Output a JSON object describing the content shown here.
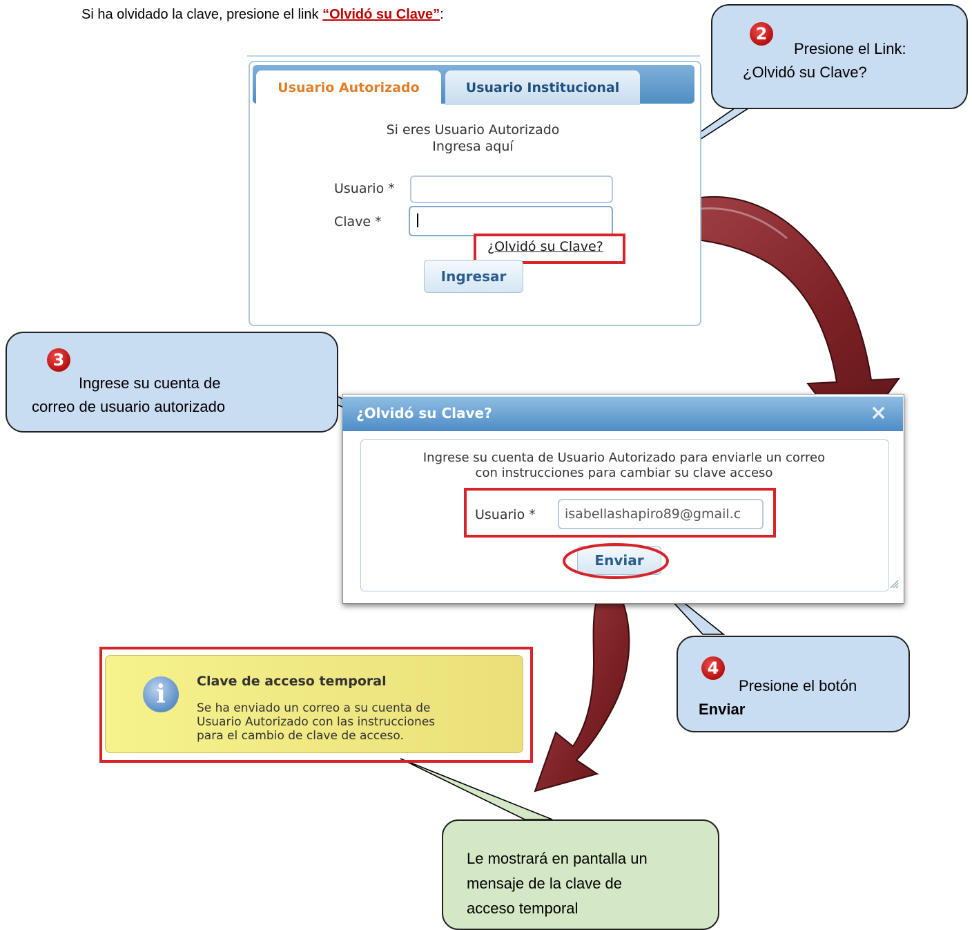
{
  "intro": {
    "text": "Si ha olvidado la clave, presione el link ",
    "link": "“Olvidó su Clave”",
    "after": ":"
  },
  "login": {
    "tabs": [
      "Usuario Autorizado",
      "Usuario Institucional"
    ],
    "greeting_line1": "Si eres Usuario Autorizado",
    "greeting_line2": "Ingresa aquí",
    "user_label": "Usuario *",
    "password_label": "Clave *",
    "forgot_link": "¿Olvidó su Clave?",
    "submit_label": "Ingresar"
  },
  "dialog": {
    "title": "¿Olvidó su Clave?",
    "close_icon": "×",
    "instructions_line1": "Ingrese su cuenta de Usuario Autorizado para enviarle un correo",
    "instructions_line2": "con instrucciones para cambiar su clave acceso",
    "user_label": "Usuario *",
    "user_value": "isabellashapiro89@gmail.c",
    "send_label": "Enviar"
  },
  "toast": {
    "title": "Clave de acceso temporal",
    "body_line1": "Se ha enviado un correo a su cuenta de",
    "body_line2": "Usuario Autorizado con las instrucciones",
    "body_line3": "para el cambio de clave de acceso.",
    "info_icon": "i"
  },
  "callouts": {
    "step2": {
      "number": "2",
      "line1": "Presione   el   Link:",
      "line2": "¿Olvidó su Clave?"
    },
    "step3": {
      "number": "3",
      "line1": "Ingrese su cuenta de",
      "line2": "correo de usuario autorizado"
    },
    "step4": {
      "number": "4",
      "line1": "Presione el botón",
      "line2": "Enviar"
    },
    "result": {
      "line1": "Le mostrará en pantalla un",
      "line2": "mensaje de la clave de",
      "line3": "acceso temporal"
    }
  },
  "colors": {
    "highlight_red": "#d8232a",
    "callout_blue": "#c8dcf2",
    "callout_green": "#d4e8c5",
    "arrow_maroon": "#8a2a2e"
  }
}
